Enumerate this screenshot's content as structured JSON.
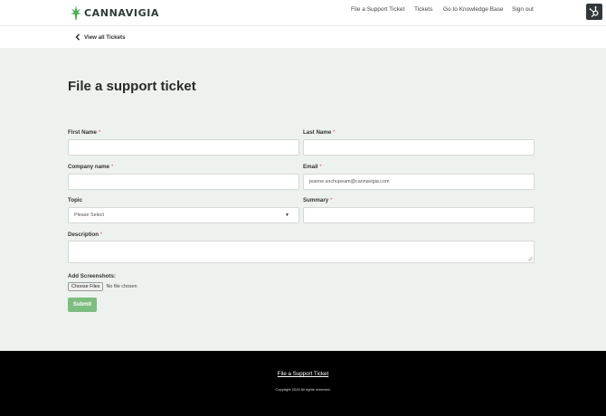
{
  "header": {
    "logo_text": "CANNAVIGIA",
    "nav": [
      {
        "label": "File a Support Ticket"
      },
      {
        "label": "Tickets"
      },
      {
        "label": "Go to Knowledge Base"
      },
      {
        "label": "Sign out"
      }
    ],
    "badge_icon": "hubspot-sprocket-icon"
  },
  "breadcrumb": {
    "icon": "chevron-left-icon",
    "label": "View all Tickets"
  },
  "form": {
    "title": "File a support ticket",
    "required_mark": "*",
    "first_name": {
      "label": "First Name",
      "value": ""
    },
    "last_name": {
      "label": "Last Name",
      "value": ""
    },
    "company": {
      "label": "Company name",
      "value": ""
    },
    "email": {
      "label": "Email",
      "value": "jeanne.snchupeam@cannavigia.com"
    },
    "topic": {
      "label": "Topic",
      "selected": "Please Select"
    },
    "summary": {
      "label": "Summary",
      "value": ""
    },
    "description": {
      "label": "Description",
      "value": ""
    },
    "screenshots": {
      "label": "Add Screenshots:",
      "button": "Choose Files",
      "status": "No file chosen"
    },
    "submit": "Submit"
  },
  "footer": {
    "link": "File a Support Ticket",
    "copyright": "Copyright 2024 All rights reserved."
  },
  "colors": {
    "accent": "#7dbd7f",
    "required": "#d9534f",
    "background": "#eef2ef"
  }
}
